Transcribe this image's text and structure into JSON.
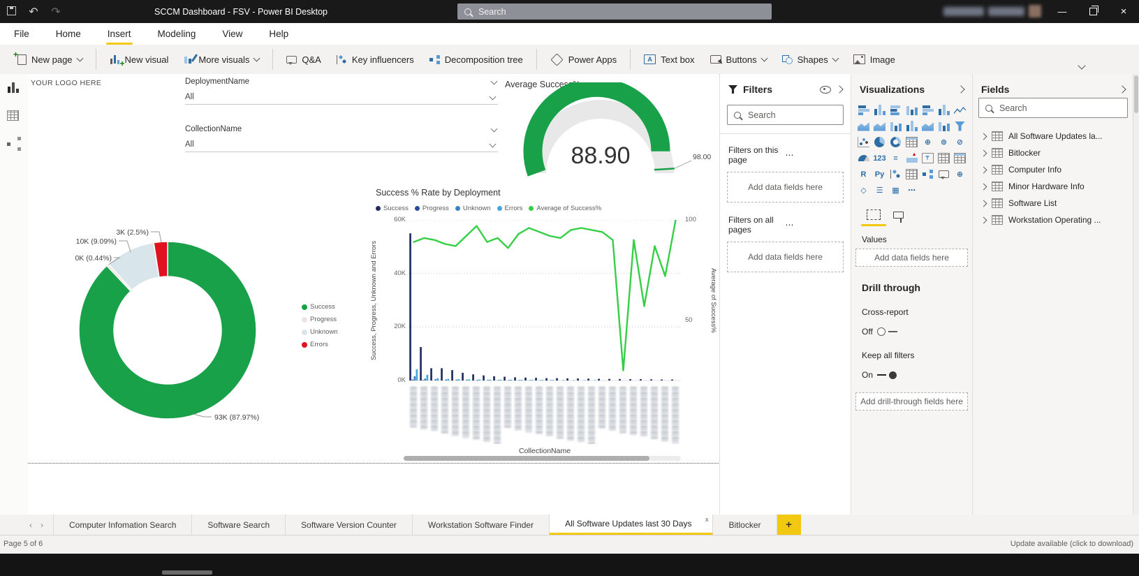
{
  "titlebar": {
    "title": "SCCM Dashboard - FSV - Power BI Desktop",
    "search_placeholder": "Search"
  },
  "menu": {
    "items": [
      "File",
      "Home",
      "Insert",
      "Modeling",
      "View",
      "Help"
    ],
    "active": "Insert"
  },
  "ribbon": {
    "groups": [
      {
        "items": [
          {
            "label": "New page",
            "icon": "new-page-icon",
            "dropdown": true
          }
        ]
      },
      {
        "items": [
          {
            "label": "New visual",
            "icon": "new-visual-icon"
          },
          {
            "label": "More visuals",
            "icon": "more-visuals-icon",
            "dropdown": true
          }
        ]
      },
      {
        "items": [
          {
            "label": "Q&A",
            "icon": "qa-icon"
          },
          {
            "label": "Key influencers",
            "icon": "key-influencers-icon"
          },
          {
            "label": "Decomposition tree",
            "icon": "decomposition-tree-icon"
          }
        ]
      },
      {
        "items": [
          {
            "label": "Power Apps",
            "icon": "power-apps-icon"
          }
        ]
      },
      {
        "items": [
          {
            "label": "Text box",
            "icon": "text-box-icon"
          },
          {
            "label": "Buttons",
            "icon": "buttons-icon",
            "dropdown": true
          },
          {
            "label": "Shapes",
            "icon": "shapes-icon",
            "dropdown": true
          },
          {
            "label": "Image",
            "icon": "image-icon"
          }
        ]
      }
    ]
  },
  "canvas": {
    "logo_text": "YOUR LOGO HERE",
    "slicers": [
      {
        "label": "DeploymentName",
        "value": "All"
      },
      {
        "label": "CollectionName",
        "value": "All"
      }
    ]
  },
  "chart_data": [
    {
      "type": "gauge",
      "title": "Average Success%",
      "value": 88.9,
      "value_label": "88.90",
      "target": 98.0,
      "target_label": "98.00",
      "min": 0,
      "max": 100,
      "fill_color": "#18A148",
      "track_color": "#e8e8e8"
    },
    {
      "type": "pie",
      "subtype": "donut",
      "slices": [
        {
          "label": "Success",
          "value_label": "93K (87.97%)",
          "pct": 87.97,
          "color": "#18A148"
        },
        {
          "label": "Progress",
          "value_label": "0K (0.44%)",
          "pct": 0.44,
          "color": "#efe3e1"
        },
        {
          "label": "Unknown",
          "value_label": "10K (9.09%)",
          "pct": 9.09,
          "color": "#d8e5ea"
        },
        {
          "label": "Errors",
          "value_label": "3K (2.5%)",
          "pct": 2.5,
          "color": "#e0121f"
        }
      ],
      "legend": [
        "Success",
        "Progress",
        "Unknown",
        "Errors"
      ],
      "legend_position": "right"
    },
    {
      "type": "combo",
      "title": "Success % Rate by Deployment",
      "legend": [
        {
          "label": "Success",
          "color": "#1f2e5e"
        },
        {
          "label": "Progress",
          "color": "#2a4d9b"
        },
        {
          "label": "Unknown",
          "color": "#3a84c4"
        },
        {
          "label": "Errors",
          "color": "#41a8dd"
        },
        {
          "label": "Average of Success%",
          "color": "#35cf45"
        }
      ],
      "y_left": {
        "label": "Success, Progress, Unknown and Errors",
        "ticks_top_to_bottom": [
          "60K",
          "40K",
          "20K",
          "0K"
        ],
        "max": 60,
        "unit": "thousands"
      },
      "y_right": {
        "label": "Average of Success%",
        "ticks_top_to_bottom": [
          "100",
          "50"
        ],
        "min": 20,
        "max": 100
      },
      "x_axis": {
        "title": "CollectionName",
        "labels_redacted": true,
        "category_count": 26
      },
      "grid": "dotted-horizontal",
      "series": [
        {
          "name": "Success",
          "unit": "thousands",
          "values": [
            55,
            12.5,
            4.6,
            4.6,
            3.9,
            2.9,
            2.3,
            1.9,
            1.6,
            1.4,
            1.2,
            1.1,
            1.0,
            0.9,
            0.85,
            0.8,
            0.75,
            0.7,
            0.65,
            0.6,
            0.55,
            0.5,
            0.5,
            0.45,
            0.4,
            0.4
          ]
        },
        {
          "name": "Progress",
          "unit": "thousands",
          "values": [
            0.3,
            0.15,
            0.1,
            0.1,
            0.1,
            0.05,
            0.05,
            0.05,
            0.05,
            0.05,
            0.05,
            0.05,
            0.05,
            0.05,
            0.05,
            0.05,
            0.05,
            0.05,
            0.05,
            0.05,
            0.05,
            0.05,
            0.05,
            0.05,
            0.05,
            0.05
          ]
        },
        {
          "name": "Unknown",
          "unit": "thousands",
          "values": [
            1.6,
            0.7,
            0.5,
            0.4,
            0.35,
            0.3,
            0.25,
            0.25,
            0.2,
            0.2,
            0.2,
            0.15,
            0.15,
            0.15,
            0.1,
            0.1,
            0.1,
            0.1,
            0.1,
            0.1,
            0.05,
            0.05,
            0.05,
            0.05,
            0.05,
            0.05
          ]
        },
        {
          "name": "Errors",
          "unit": "thousands",
          "values": [
            4.2,
            2.1,
            0.9,
            0.6,
            0.5,
            0.45,
            0.4,
            0.35,
            0.3,
            0.3,
            0.25,
            0.25,
            0.2,
            0.2,
            0.2,
            0.15,
            0.15,
            0.15,
            0.1,
            0.1,
            0.1,
            0.1,
            0.1,
            0.1,
            0.1,
            0.1
          ]
        }
      ],
      "line_series": {
        "name": "Average of Success%",
        "axis": "right",
        "values": [
          89,
          91,
          90,
          88,
          87,
          92,
          97,
          89,
          91,
          86,
          93,
          96,
          94,
          92,
          91,
          95,
          96,
          95,
          94,
          90,
          25,
          90,
          57,
          87,
          72,
          100
        ]
      }
    }
  ],
  "filters_pane": {
    "title": "Filters",
    "search_placeholder": "Search",
    "sections": [
      {
        "label": "Filters on this page",
        "placeholder": "Add data fields here"
      },
      {
        "label": "Filters on all pages",
        "placeholder": "Add data fields here"
      }
    ]
  },
  "visualizations_pane": {
    "title": "Visualizations",
    "values_label": "Values",
    "values_placeholder": "Add data fields here",
    "drill_through": {
      "heading": "Drill through",
      "cross_report_label": "Cross-report",
      "cross_report_state": "Off",
      "keep_filters_label": "Keep all filters",
      "keep_filters_state": "On",
      "placeholder": "Add drill-through fields here"
    },
    "visual_icons": [
      {
        "name": "stacked-bar-chart",
        "kind": "barh"
      },
      {
        "name": "stacked-column-chart",
        "kind": "colv"
      },
      {
        "name": "clustered-bar-chart",
        "kind": "barh2"
      },
      {
        "name": "clustered-column-chart",
        "kind": "colv2"
      },
      {
        "name": "100-stacked-bar-chart",
        "kind": "barh"
      },
      {
        "name": "100-stacked-column-chart",
        "kind": "colv"
      },
      {
        "name": "line-chart",
        "kind": "line"
      },
      {
        "name": "area-chart",
        "kind": "area"
      },
      {
        "name": "stacked-area-chart",
        "kind": "area"
      },
      {
        "name": "line-and-stacked-column-chart",
        "kind": "colv2"
      },
      {
        "name": "line-and-clustered-column-chart",
        "kind": "colv"
      },
      {
        "name": "ribbon-chart",
        "kind": "area"
      },
      {
        "name": "waterfall-chart",
        "kind": "colv2"
      },
      {
        "name": "funnel-chart",
        "kind": "funl"
      },
      {
        "name": "scatter-chart",
        "kind": "scat"
      },
      {
        "name": "pie-chart",
        "kind": "pie"
      },
      {
        "name": "donut-chart",
        "kind": "donutk"
      },
      {
        "name": "treemap",
        "kind": "mtx"
      },
      {
        "name": "map",
        "kind": "glyph",
        "glyph": "⊕"
      },
      {
        "name": "filled-map",
        "kind": "glyph",
        "glyph": "⊚"
      },
      {
        "name": "shape-map",
        "kind": "glyph",
        "glyph": "⊘"
      },
      {
        "name": "gauge",
        "kind": "gaug"
      },
      {
        "name": "card",
        "kind": "glyph",
        "glyph": "123"
      },
      {
        "name": "multi-row-card",
        "kind": "glyph",
        "glyph": "≡"
      },
      {
        "name": "kpi",
        "kind": "kpi"
      },
      {
        "name": "slicer",
        "kind": "slic"
      },
      {
        "name": "table",
        "kind": "tbl"
      },
      {
        "name": "matrix",
        "kind": "mtx"
      },
      {
        "name": "r-script-visual",
        "kind": "glyph",
        "glyph": "R"
      },
      {
        "name": "python-visual",
        "kind": "glyph",
        "glyph": "Py"
      },
      {
        "name": "key-influencers",
        "kind": "keyi"
      },
      {
        "name": "paginated-report",
        "kind": "tbl"
      },
      {
        "name": "decomposition-tree",
        "kind": "tree"
      },
      {
        "name": "qa-visual",
        "kind": "bub"
      },
      {
        "name": "arcgis-map",
        "kind": "glyph",
        "glyph": "⊕"
      },
      {
        "name": "power-apps-visual",
        "kind": "glyph",
        "glyph": "◇"
      },
      {
        "name": "smart-narrative",
        "kind": "glyph",
        "glyph": "☰"
      },
      {
        "name": "custom-visual",
        "kind": "glyph",
        "glyph": "▦"
      },
      {
        "name": "more-options",
        "kind": "glyph",
        "glyph": "⋯"
      }
    ]
  },
  "fields_pane": {
    "title": "Fields",
    "search_placeholder": "Search",
    "tables": [
      "All Software Updates la...",
      "Bitlocker",
      "Computer Info",
      "Minor Hardware Info",
      "Software List",
      "Workstation Operating ..."
    ]
  },
  "page_tabs": {
    "tabs": [
      {
        "label": "Computer Infomation Search",
        "active": false
      },
      {
        "label": "Software Search",
        "active": false
      },
      {
        "label": "Software Version Counter",
        "active": false
      },
      {
        "label": "Workstation Software Finder",
        "active": false
      },
      {
        "label": "All Software Updates last 30 Days",
        "active": true,
        "closable": true
      },
      {
        "label": "Bitlocker",
        "active": false
      }
    ],
    "add_label": "+"
  },
  "status_bar": {
    "left": "Page 5 of 6",
    "right": "Update available (click to download)"
  },
  "colors": {
    "accent_yellow": "#F2C811",
    "success_green": "#18A148",
    "error_red": "#E0121F",
    "bar_navy": "#1f2e5e",
    "line_green": "#35cf45"
  }
}
